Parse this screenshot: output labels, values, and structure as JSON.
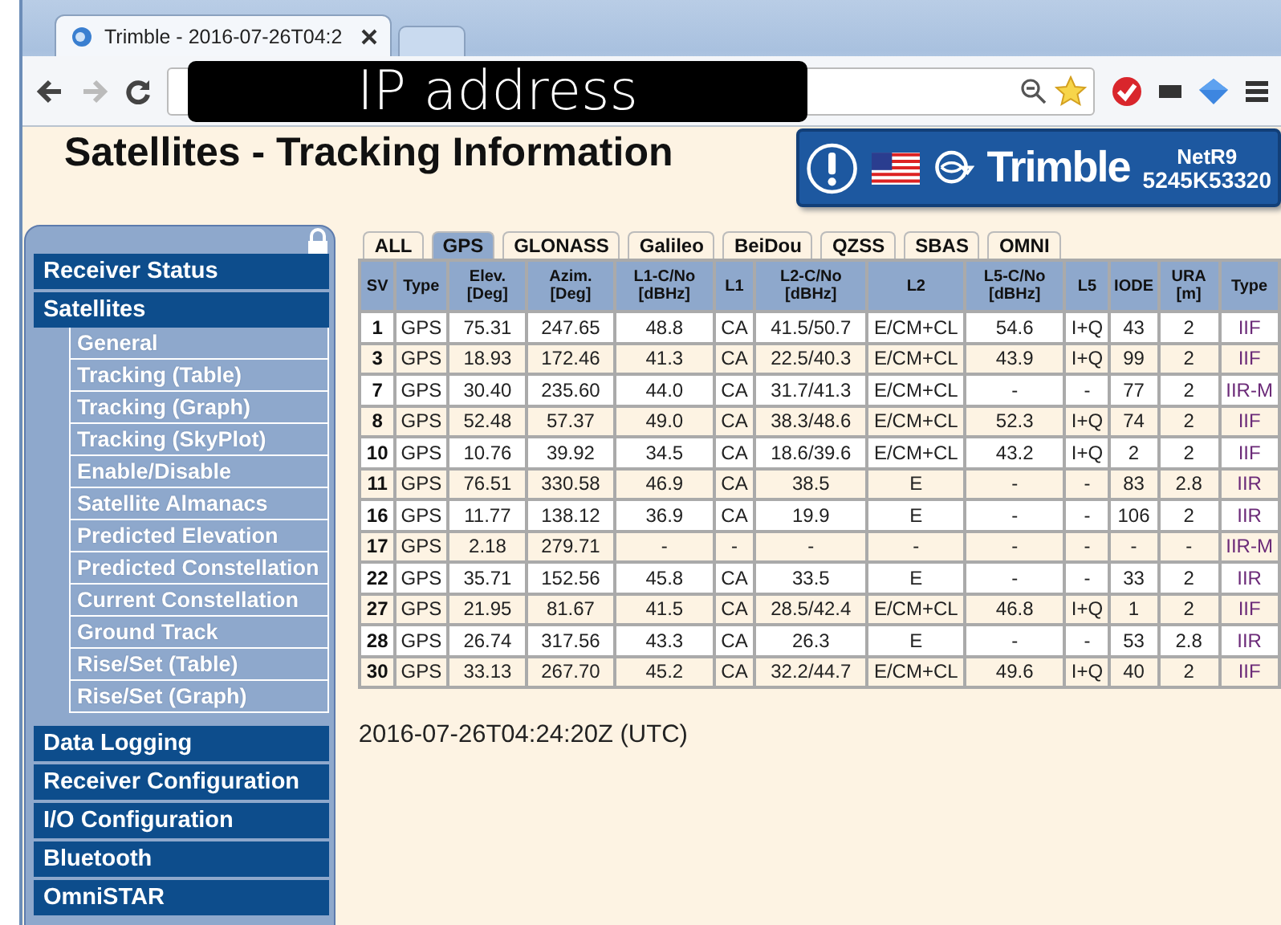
{
  "browser": {
    "tab_title": "Trimble - 2016-07-26T04:2",
    "redaction": "IP address"
  },
  "page": {
    "title": "Satellites - Tracking Information",
    "badge": {
      "brand": "Trimble",
      "model": "NetR9",
      "serial": "5245K53320"
    }
  },
  "sidebar": {
    "items": [
      {
        "label": "Receiver Status"
      },
      {
        "label": "Satellites",
        "children": [
          {
            "label": "General"
          },
          {
            "label": "Tracking (Table)"
          },
          {
            "label": "Tracking (Graph)"
          },
          {
            "label": "Tracking (SkyPlot)"
          },
          {
            "label": "Enable/Disable"
          },
          {
            "label": "Satellite Almanacs"
          },
          {
            "label": "Predicted Elevation"
          },
          {
            "label": "Predicted Constellation"
          },
          {
            "label": "Current Constellation"
          },
          {
            "label": "Ground Track"
          },
          {
            "label": "Rise/Set (Table)"
          },
          {
            "label": "Rise/Set (Graph)"
          }
        ]
      },
      {
        "label": "Data Logging"
      },
      {
        "label": "Receiver Configuration"
      },
      {
        "label": "I/O Configuration"
      },
      {
        "label": "Bluetooth"
      },
      {
        "label": "OmniSTAR"
      }
    ]
  },
  "tabs": [
    {
      "label": "ALL",
      "selected": false
    },
    {
      "label": "GPS",
      "selected": true
    },
    {
      "label": "GLONASS",
      "selected": false
    },
    {
      "label": "Galileo",
      "selected": false
    },
    {
      "label": "BeiDou",
      "selected": false
    },
    {
      "label": "QZSS",
      "selected": false
    },
    {
      "label": "SBAS",
      "selected": false
    },
    {
      "label": "OMNI",
      "selected": false
    }
  ],
  "table": {
    "columns": [
      "SV",
      "Type",
      "Elev. [Deg]",
      "Azim. [Deg]",
      "L1-C/No [dBHz]",
      "L1",
      "L2-C/No [dBHz]",
      "L2",
      "L5-C/No [dBHz]",
      "L5",
      "IODE",
      "URA [m]",
      "Type"
    ],
    "rows": [
      [
        "1",
        "GPS",
        "75.31",
        "247.65",
        "48.8",
        "CA",
        "41.5/50.7",
        "E/CM+CL",
        "54.6",
        "I+Q",
        "43",
        "2",
        "IIF"
      ],
      [
        "3",
        "GPS",
        "18.93",
        "172.46",
        "41.3",
        "CA",
        "22.5/40.3",
        "E/CM+CL",
        "43.9",
        "I+Q",
        "99",
        "2",
        "IIF"
      ],
      [
        "7",
        "GPS",
        "30.40",
        "235.60",
        "44.0",
        "CA",
        "31.7/41.3",
        "E/CM+CL",
        "-",
        "-",
        "77",
        "2",
        "IIR-M"
      ],
      [
        "8",
        "GPS",
        "52.48",
        "57.37",
        "49.0",
        "CA",
        "38.3/48.6",
        "E/CM+CL",
        "52.3",
        "I+Q",
        "74",
        "2",
        "IIF"
      ],
      [
        "10",
        "GPS",
        "10.76",
        "39.92",
        "34.5",
        "CA",
        "18.6/39.6",
        "E/CM+CL",
        "43.2",
        "I+Q",
        "2",
        "2",
        "IIF"
      ],
      [
        "11",
        "GPS",
        "76.51",
        "330.58",
        "46.9",
        "CA",
        "38.5",
        "E",
        "-",
        "-",
        "83",
        "2.8",
        "IIR"
      ],
      [
        "16",
        "GPS",
        "11.77",
        "138.12",
        "36.9",
        "CA",
        "19.9",
        "E",
        "-",
        "-",
        "106",
        "2",
        "IIR"
      ],
      [
        "17",
        "GPS",
        "2.18",
        "279.71",
        "-",
        "-",
        "-",
        "-",
        "-",
        "-",
        "-",
        "-",
        "IIR-M"
      ],
      [
        "22",
        "GPS",
        "35.71",
        "152.56",
        "45.8",
        "CA",
        "33.5",
        "E",
        "-",
        "-",
        "33",
        "2",
        "IIR"
      ],
      [
        "27",
        "GPS",
        "21.95",
        "81.67",
        "41.5",
        "CA",
        "28.5/42.4",
        "E/CM+CL",
        "46.8",
        "I+Q",
        "1",
        "2",
        "IIF"
      ],
      [
        "28",
        "GPS",
        "26.74",
        "317.56",
        "43.3",
        "CA",
        "26.3",
        "E",
        "-",
        "-",
        "53",
        "2.8",
        "IIR"
      ],
      [
        "30",
        "GPS",
        "33.13",
        "267.70",
        "45.2",
        "CA",
        "32.2/44.7",
        "E/CM+CL",
        "49.6",
        "I+Q",
        "40",
        "2",
        "IIF"
      ]
    ]
  },
  "timestamp": "2016-07-26T04:24:20Z (UTC)"
}
